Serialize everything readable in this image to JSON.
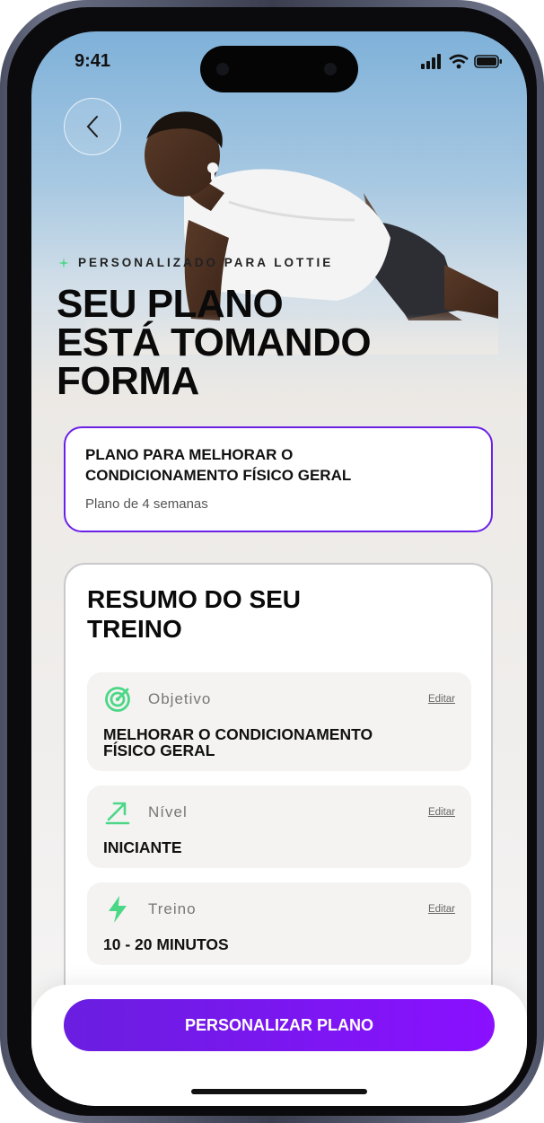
{
  "status_bar": {
    "time": "9:41"
  },
  "header": {
    "eyebrow": "PERSONALIZADO PARA LOTTIE"
  },
  "headline": [
    "SEU PLANO",
    "ESTÁ TOMANDO",
    "FORMA"
  ],
  "plan": {
    "title_line1": "PLANO PARA MELHORAR O",
    "title_line2": "CONDICIONAMENTO FÍSICO GERAL",
    "subtitle": "Plano de 4 semanas"
  },
  "summary": {
    "title_line1": "RESUMO DO SEU",
    "title_line2": "TREINO",
    "items": [
      {
        "label": "Objetivo",
        "edit": "Editar",
        "value_line1": "MELHORAR O CONDICIONAMENTO",
        "value_line2": "FÍSICO GERAL",
        "icon": "target-icon"
      },
      {
        "label": "Nível",
        "edit": "Editar",
        "value_line1": "INICIANTE",
        "icon": "trend-arrow-icon"
      },
      {
        "label": "Treino",
        "edit": "Editar",
        "value_line1": "10 - 20 MINUTOS",
        "icon": "lightning-icon"
      }
    ]
  },
  "cta": {
    "label": "PERSONALIZAR PLANO"
  },
  "colors": {
    "accent": "#6a21e8",
    "icon_green": "#4cd787"
  }
}
